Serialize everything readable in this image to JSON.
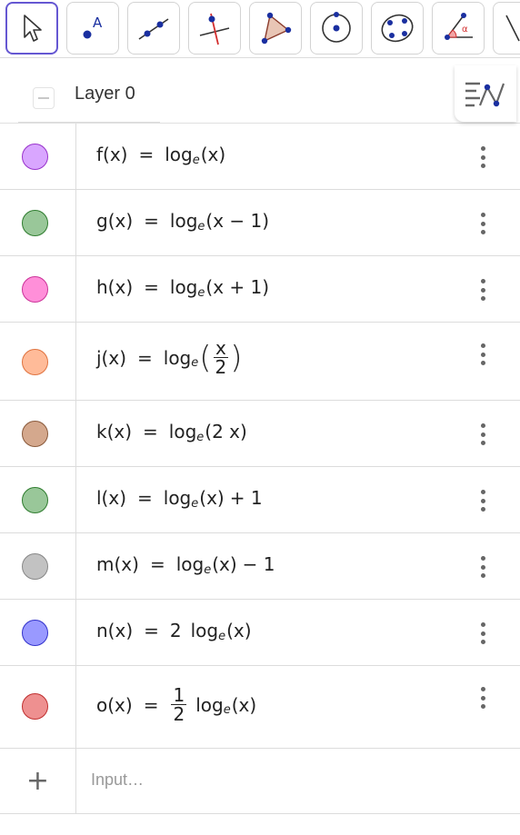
{
  "toolbar": {
    "tools": [
      {
        "name": "move-tool"
      },
      {
        "name": "point-tool",
        "label": "A"
      },
      {
        "name": "line-tool"
      },
      {
        "name": "perpendicular-line-tool"
      },
      {
        "name": "polygon-tool"
      },
      {
        "name": "circle-center-point-tool"
      },
      {
        "name": "conic-through-points-tool"
      },
      {
        "name": "angle-tool",
        "label": "α"
      },
      {
        "name": "reflect-tool"
      }
    ],
    "selected_tool": "move-tool",
    "accent_color": "#6557d2"
  },
  "layer": {
    "title": "Layer 0"
  },
  "functions": [
    {
      "id": "f",
      "color": "#d9a6ff",
      "border": "#9933cc",
      "lhs": "f(x)",
      "rhs": {
        "pre": "log",
        "base": "e",
        "arg": "(x)",
        "post": ""
      }
    },
    {
      "id": "g",
      "color": "#99c799",
      "border": "#2f7d2f",
      "lhs": "g(x)",
      "rhs": {
        "pre": "log",
        "base": "e",
        "arg": "(x − 1)",
        "post": ""
      }
    },
    {
      "id": "h",
      "color": "#ff8fd9",
      "border": "#cc3399",
      "lhs": "h(x)",
      "rhs": {
        "pre": "log",
        "base": "e",
        "arg": "(x + 1)",
        "post": ""
      }
    },
    {
      "id": "j",
      "color": "#ffbb99",
      "border": "#e0733f",
      "lhs": "j(x)",
      "rhs": {
        "pre": "log",
        "base": "e",
        "frac_num": "x",
        "frac_den": "2"
      }
    },
    {
      "id": "k",
      "color": "#d4a88d",
      "border": "#8a5a3c",
      "lhs": "k(x)",
      "rhs": {
        "pre": "log",
        "base": "e",
        "arg": "(2 x)",
        "post": ""
      }
    },
    {
      "id": "l",
      "color": "#99c799",
      "border": "#2f7d2f",
      "lhs": "l(x)",
      "rhs": {
        "pre": "log",
        "base": "e",
        "arg": "(x)",
        "post": "+ 1"
      }
    },
    {
      "id": "m",
      "color": "#c2c2c2",
      "border": "#888888",
      "lhs": "m(x)",
      "rhs": {
        "pre": "log",
        "base": "e",
        "arg": "(x)",
        "post": "− 1"
      }
    },
    {
      "id": "n",
      "color": "#9999ff",
      "border": "#3333cc",
      "lhs": "n(x)",
      "rhs": {
        "coef": "2",
        "pre": "log",
        "base": "e",
        "arg": "(x)",
        "post": ""
      }
    },
    {
      "id": "o",
      "color": "#ee9090",
      "border": "#c03030",
      "lhs": "o(x)",
      "rhs": {
        "coef_num": "1",
        "coef_den": "2",
        "pre": "log",
        "base": "e",
        "arg": "(x)",
        "post": ""
      }
    }
  ],
  "equals": "=",
  "input": {
    "placeholder": "Input…",
    "add_symbol": "+"
  }
}
